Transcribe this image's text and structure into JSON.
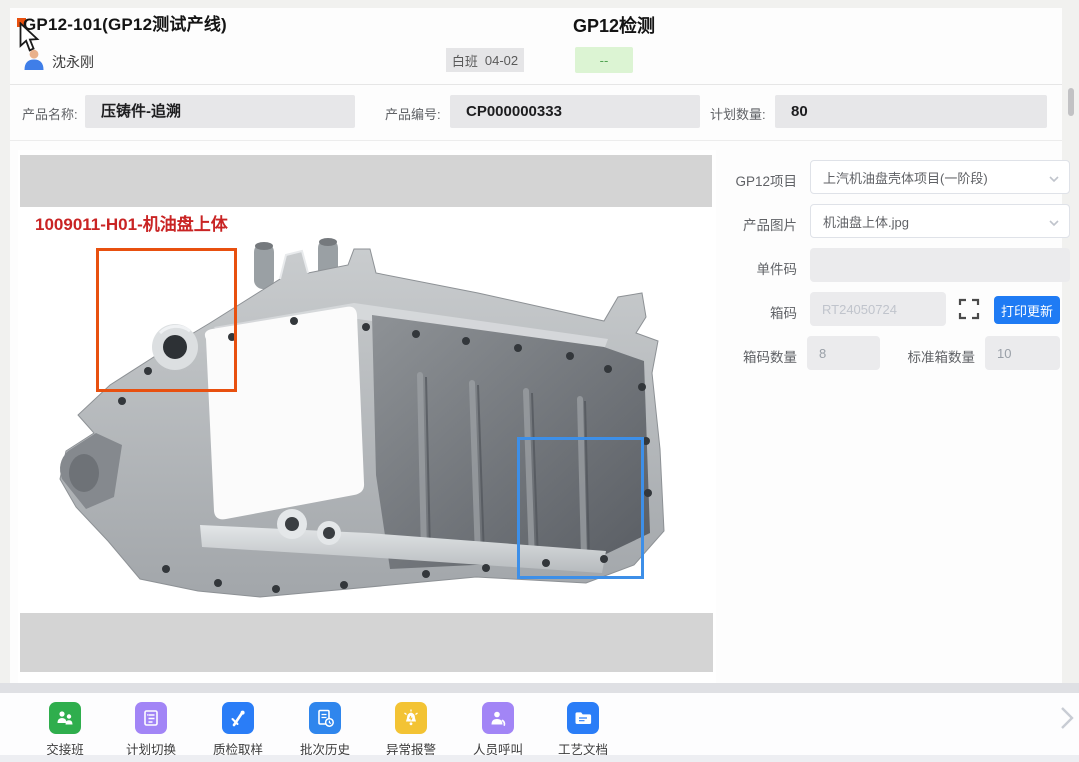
{
  "header": {
    "line_title": "GP12-101(GP12测试产线)",
    "operator_name": "沈永刚",
    "page_title": "GP12检测",
    "shift_label": "白班",
    "shift_date": "04-02",
    "status_value": "--"
  },
  "product_form": {
    "fields": [
      {
        "label": "产品名称:",
        "value": "压铸件-追溯"
      },
      {
        "label": "产品编号:",
        "value": "CP000000333"
      },
      {
        "label": "计划数量:",
        "value": "80"
      }
    ]
  },
  "image_panel": {
    "part_caption": "1009011-H01-机油盘上体"
  },
  "gp12_panel": {
    "project_label": "GP12项目",
    "project_value": "上汽机油盘壳体项目(一阶段)",
    "picture_label": "产品图片",
    "picture_value": "机油盘上体.jpg",
    "unit_code_label": "单件码",
    "box_code_label": "箱码",
    "box_code_placeholder": "RT24050724",
    "print_update_button": "打印更新",
    "box_count_label": "箱码数量",
    "box_count_value": "8",
    "standard_box_label": "标准箱数量",
    "standard_box_value": "10"
  },
  "toolbar": {
    "items": [
      {
        "label": "交接班",
        "color": "#2fae4d"
      },
      {
        "label": "计划切换",
        "color": "#a285f6"
      },
      {
        "label": "质检取样",
        "color": "#2a7df7"
      },
      {
        "label": "批次历史",
        "color": "#2f86ed"
      },
      {
        "label": "异常报警",
        "color": "#f3c334"
      },
      {
        "label": "人员呼叫",
        "color": "#a285f6"
      },
      {
        "label": "工艺文档",
        "color": "#2a7df7"
      }
    ]
  },
  "colors": {
    "accent_blue": "#1f7bf4",
    "highlight_orange": "#e8500f",
    "highlight_blue": "#3d8fe8",
    "status_green": "#52a352",
    "caption_red": "#c92424"
  }
}
